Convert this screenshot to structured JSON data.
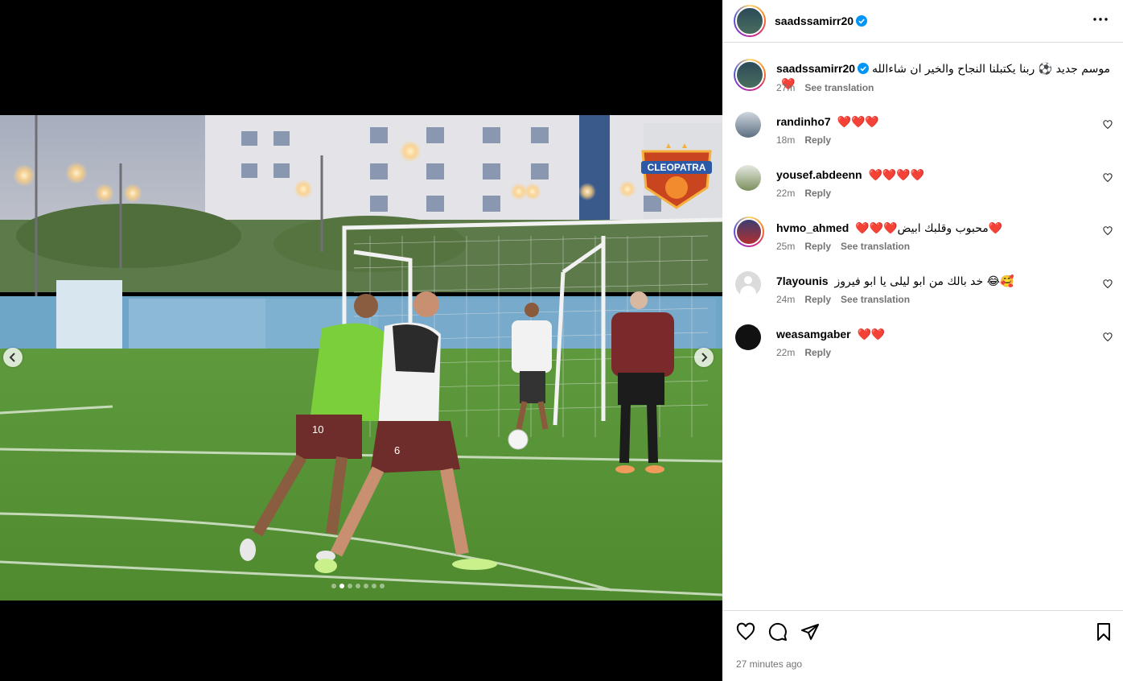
{
  "post": {
    "username": "saadssamirr20",
    "caption_text": "موسم جديد ⚽ ربنا يكتبلنا النجاح والخير ان شاءالله ❤️",
    "caption_time": "27m",
    "see_translation": "See translation",
    "timestamp": "27 minutes ago"
  },
  "carousel": {
    "total_slides": 7,
    "active_slide": 2
  },
  "comments": [
    {
      "username": "randinho7",
      "text": "❤️❤️❤️",
      "time": "18m",
      "reply": "Reply",
      "translation": ""
    },
    {
      "username": "yousef.abdeenn",
      "text": "❤️❤️❤️❤️",
      "time": "22m",
      "reply": "Reply",
      "translation": ""
    },
    {
      "username": "hvmo_ahmed",
      "text": "❤️❤️❤️محبوب وقلبك ابيض❤️",
      "time": "25m",
      "reply": "Reply",
      "translation": "See translation"
    },
    {
      "username": "7layounis",
      "text": "خد بالك من ابو ليلى يا ابو فيروز 😂🥰",
      "time": "24m",
      "reply": "Reply",
      "translation": "See translation"
    },
    {
      "username": "weasamgaber",
      "text": "❤️❤️",
      "time": "22m",
      "reply": "Reply",
      "translation": ""
    }
  ],
  "photo": {
    "club_logo_text": "CLEOPATRA",
    "player_numbers": [
      "10",
      "6"
    ]
  },
  "colors": {
    "verified_blue": "#0095f6",
    "meta_gray": "#737373",
    "border": "#dbdbdb"
  },
  "icons": {
    "like": "heart-icon",
    "comment": "comment-icon",
    "share": "paper-plane-icon",
    "save": "bookmark-icon",
    "more": "more-horizontal-icon"
  }
}
